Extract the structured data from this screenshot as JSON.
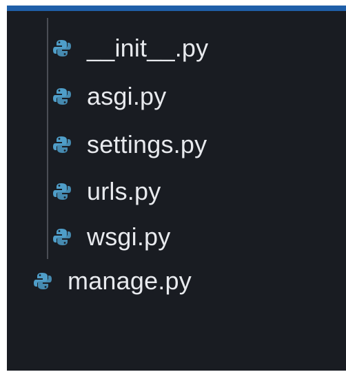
{
  "explorer": {
    "folder_items": [
      {
        "label": "__init__.py",
        "icon": "python-file-icon"
      },
      {
        "label": "asgi.py",
        "icon": "python-file-icon"
      },
      {
        "label": "settings.py",
        "icon": "python-file-icon"
      },
      {
        "label": "urls.py",
        "icon": "python-file-icon"
      },
      {
        "label": "wsgi.py",
        "icon": "python-file-icon"
      }
    ],
    "root_items": [
      {
        "label": "manage.py",
        "icon": "python-file-icon"
      }
    ]
  },
  "colors": {
    "background": "#191c22",
    "text": "#e8eaee",
    "python_icon": "#4f9ec9",
    "accent_bar": "#1f5fa8"
  }
}
